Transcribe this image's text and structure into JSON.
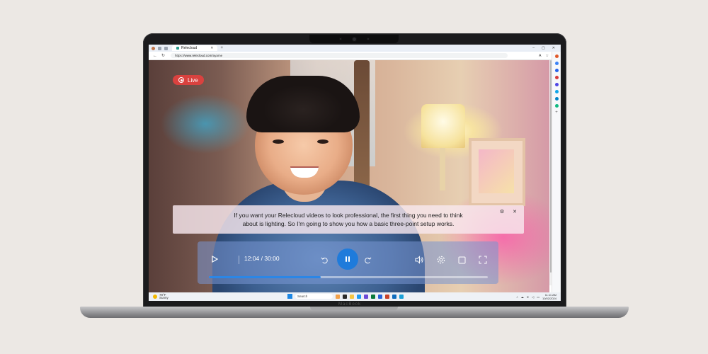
{
  "browser": {
    "tab_title": "Relecloud",
    "url_prefix": "https://",
    "url_host": "www.relecloud.com",
    "url_path": "/ayame"
  },
  "video": {
    "live_label": "Live",
    "caption_line1": "If you want your Relecloud videos to look professional, the first thing you need to think",
    "caption_line2": "about is lighting. So I'm going to show you how a basic three-point setup works.",
    "time_display": "12:04 / 30:00",
    "progress_fraction": 0.4
  },
  "taskbar": {
    "weather_temp": "78°F",
    "weather_desc": "Sunny",
    "search_placeholder": "Search",
    "time": "11:11 AM",
    "date": "10/02/2024"
  },
  "laptop": {
    "brand": "MacBook"
  },
  "colors": {
    "accent": "#1f7bdb",
    "live": "#d9423f"
  }
}
